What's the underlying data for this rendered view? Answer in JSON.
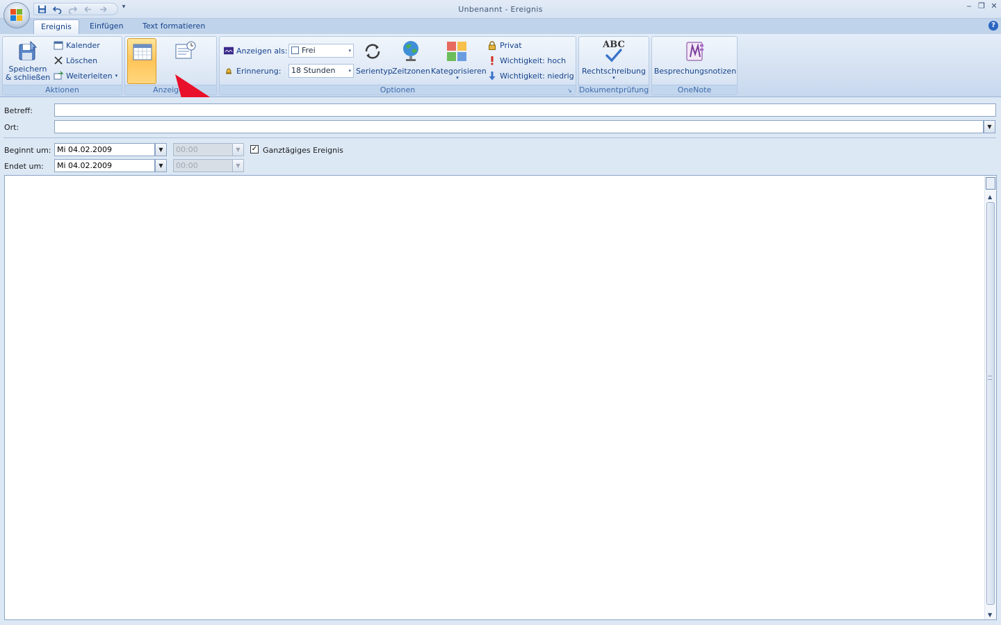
{
  "window": {
    "title": "Unbenannt - Ereignis",
    "controls": [
      "‒",
      "❐",
      "✕"
    ]
  },
  "qat": {
    "icons": [
      "save-icon",
      "undo-icon",
      "redo-icon",
      "previous-icon",
      "next-icon"
    ],
    "more_glyph": "▾"
  },
  "tabs": [
    {
      "label": "Ereignis",
      "active": true
    },
    {
      "label": "Einfügen",
      "active": false
    },
    {
      "label": "Text formatieren",
      "active": false
    }
  ],
  "help_glyph": "?",
  "ribbon": {
    "aktionen": {
      "label": "Aktionen",
      "save_close": [
        "Speichern",
        "& schließen"
      ],
      "kalender": "Kalender",
      "loeschen": "Löschen",
      "weiterleiten": "Weiterleiten"
    },
    "anzeigen": {
      "label": "Anzeigen"
    },
    "optionen": {
      "label": "Optionen",
      "anzeigen_als_label": "Anzeigen als:",
      "anzeigen_als_value": "Frei",
      "erinnerung_label": "Erinnerung:",
      "erinnerung_value": "18 Stunden",
      "serientyp": "Serientyp",
      "zeitzonen": "Zeitzonen",
      "kategorisieren": "Kategorisieren",
      "privat": "Privat",
      "wichtigkeit_hoch": "Wichtigkeit: hoch",
      "wichtigkeit_niedrig": "Wichtigkeit: niedrig"
    },
    "dokumentpruefung": {
      "label": "Dokumentprüfung",
      "rechtschreibung": "Rechtschreibung",
      "abc": "ABC"
    },
    "onenote": {
      "label": "OneNote",
      "besprechungsnotizen": "Besprechungsnotizen"
    }
  },
  "form": {
    "betreff_label": "Betreff:",
    "betreff_value": "",
    "ort_label": "Ort:",
    "ort_value": "",
    "beginnt_label": "Beginnt um:",
    "beginnt_date": "Mi 04.02.2009",
    "beginnt_time": "00:00",
    "endet_label": "Endet um:",
    "endet_date": "Mi 04.02.2009",
    "endet_time": "00:00",
    "ganztaegig_label": "Ganztägiges Ereignis",
    "ganztaegig_checked": true
  },
  "colors": {
    "arrow": "#e8102a",
    "accent": "#15428b",
    "selected_view": "#ffc55a"
  }
}
